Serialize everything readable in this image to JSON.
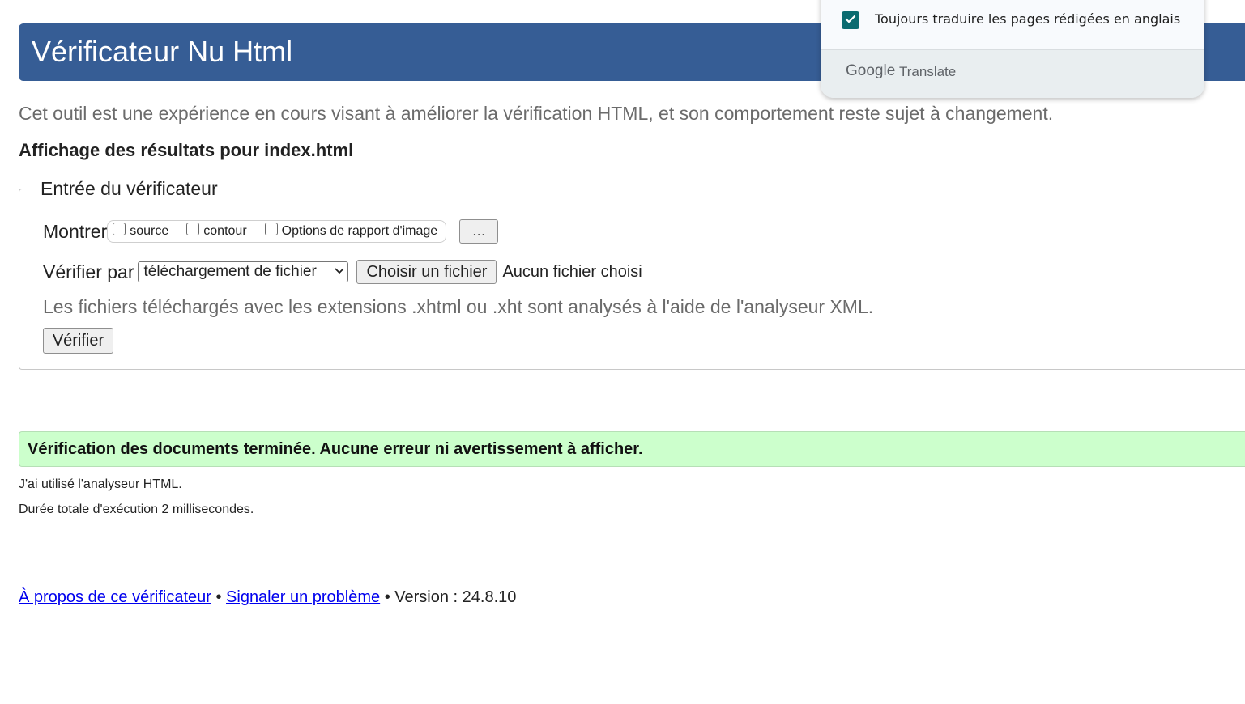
{
  "header": {
    "title": "Vérificateur Nu Html"
  },
  "intro": "Cet outil est une expérience en cours visant à améliorer la vérification HTML, et son comportement reste sujet à changement.",
  "results_heading": "Affichage des résultats pour index.html",
  "checker_input": {
    "legend": "Entrée du vérificateur",
    "show_label": "Montrer",
    "options": [
      {
        "label": "source",
        "checked": false
      },
      {
        "label": "contour",
        "checked": false
      },
      {
        "label": "Options de rapport d'image",
        "checked": false
      }
    ],
    "more_button_label": "…",
    "check_by_label": "Vérifier par",
    "check_by_selected": "téléchargement de fichier",
    "choose_file_label": "Choisir un fichier",
    "no_file_text": "Aucun fichier choisi",
    "parser_note": "Les fichiers téléchargés avec les extensions .xhtml ou .xht sont analysés à l'aide de l'analyseur XML.",
    "verify_button_label": "Vérifier"
  },
  "result": {
    "success_message": "Vérification des documents terminée. Aucune erreur ni avertissement à afficher.",
    "success_color": "#ccffcc",
    "parser_used": "J'ai utilisé l'analyseur HTML.",
    "execution_time": "Durée totale d'exécution 2 millisecondes."
  },
  "footer": {
    "about_link": "À propos de ce vérificateur",
    "separator_1": " • ",
    "report_link": "Signaler un problème",
    "separator_2": " • ",
    "version_text": "Version : 24.8.10"
  },
  "translate_popup": {
    "always_translate_label": "Toujours traduire les pages rédigées en anglais",
    "always_translate_checked": true,
    "brand_google": "Google",
    "brand_translate": "Translate",
    "checkbox_color": "#0b6b70"
  },
  "colors": {
    "header_bg": "#365d95",
    "link": "#0000ee"
  }
}
